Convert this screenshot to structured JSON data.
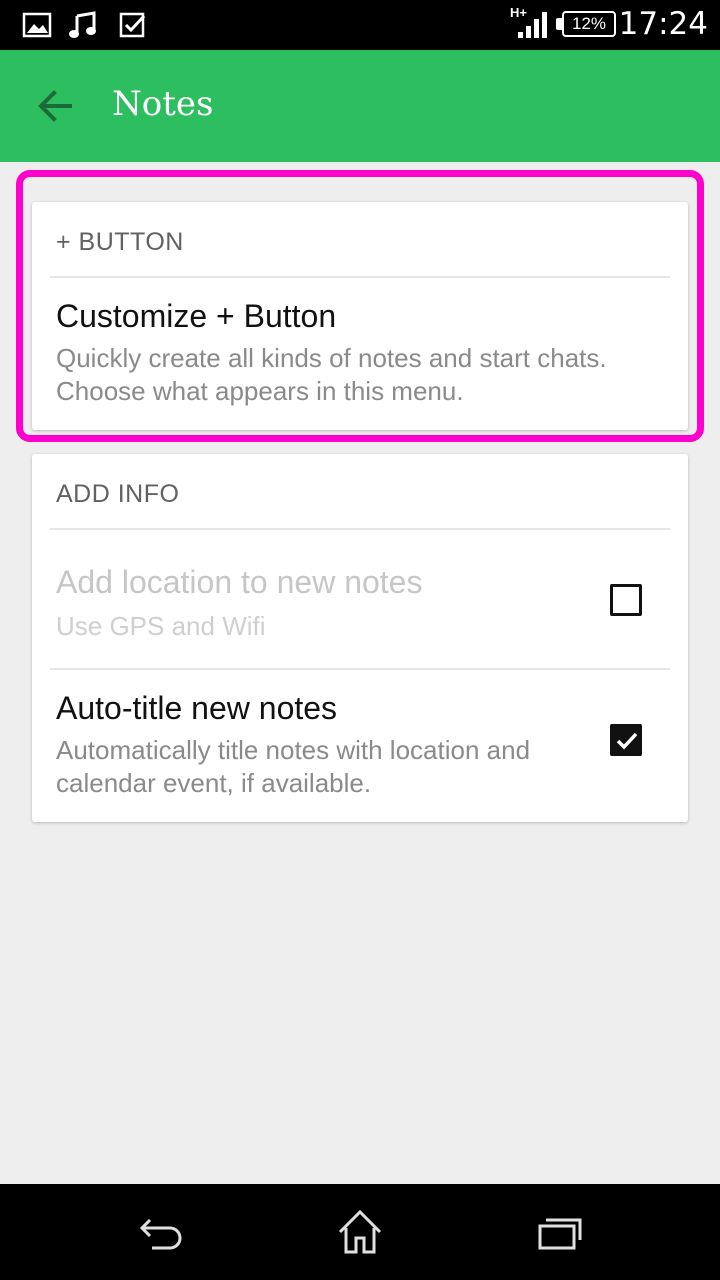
{
  "status_bar": {
    "network": "H+",
    "battery": "12%",
    "time": "17:24",
    "icons": [
      "image-icon",
      "music-note-icon",
      "checkbox-icon",
      "signal-icon",
      "battery-icon"
    ]
  },
  "app_bar": {
    "title": "Notes",
    "color": "#2dbe60"
  },
  "sections": {
    "plus_button": {
      "header": "+ BUTTON",
      "item": {
        "title": "Customize + Button",
        "subtitle": "Quickly create all kinds of notes and start chats. Choose what appears in this menu."
      }
    },
    "add_info": {
      "header": "ADD INFO",
      "items": [
        {
          "title": "Add location to new notes",
          "subtitle": "Use GPS and Wifi",
          "checked": false,
          "enabled": false
        },
        {
          "title": "Auto-title new notes",
          "subtitle": "Automatically title notes with location and calendar event, if available.",
          "checked": true,
          "enabled": true
        }
      ]
    }
  },
  "highlight_color": "#ff00cc",
  "nav_bar": {
    "icons": [
      "back-icon",
      "home-icon",
      "recent-apps-icon"
    ]
  }
}
